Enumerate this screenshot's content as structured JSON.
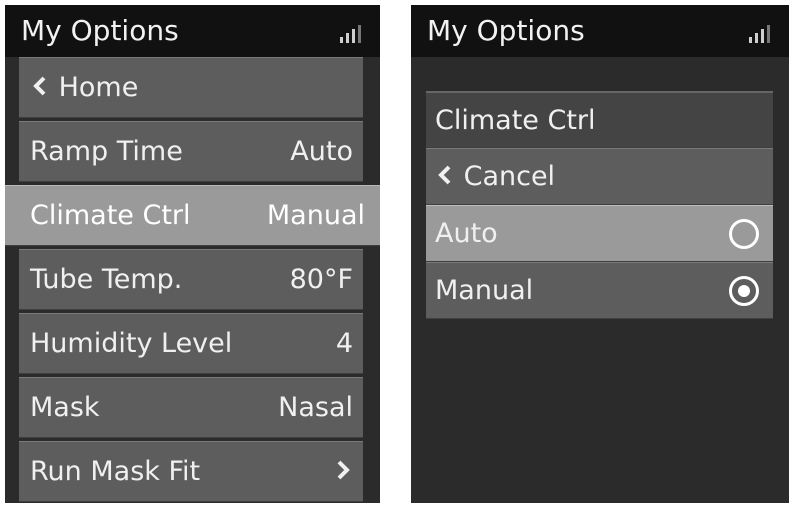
{
  "left_screen": {
    "title": "My Options",
    "signal_icon": "signal-bars-icon",
    "menu": [
      {
        "label": "Home",
        "value": "",
        "icon": "chevron-left-icon"
      },
      {
        "label": "Ramp Time",
        "value": "Auto"
      },
      {
        "label": "Climate Ctrl",
        "value": "Manual",
        "selected": true
      },
      {
        "label": "Tube Temp.",
        "value": "80°F"
      },
      {
        "label": "Humidity Level",
        "value": "4"
      },
      {
        "label": "Mask",
        "value": "Nasal"
      },
      {
        "label": "Run Mask Fit",
        "value": "",
        "icon": "chevron-right-icon"
      }
    ]
  },
  "right_screen": {
    "title": "My Options",
    "signal_icon": "signal-bars-icon",
    "header": "Climate Ctrl",
    "cancel_label": "Cancel",
    "options": [
      {
        "label": "Auto",
        "checked": false
      },
      {
        "label": "Manual",
        "checked": true
      }
    ]
  },
  "colors": {
    "screen_bg": "#2b2b2b",
    "top_bar": "#111111",
    "item_bg": "#5d5d5d",
    "selected_bg": "#9a9a9a",
    "text": "#f0f0f0"
  }
}
